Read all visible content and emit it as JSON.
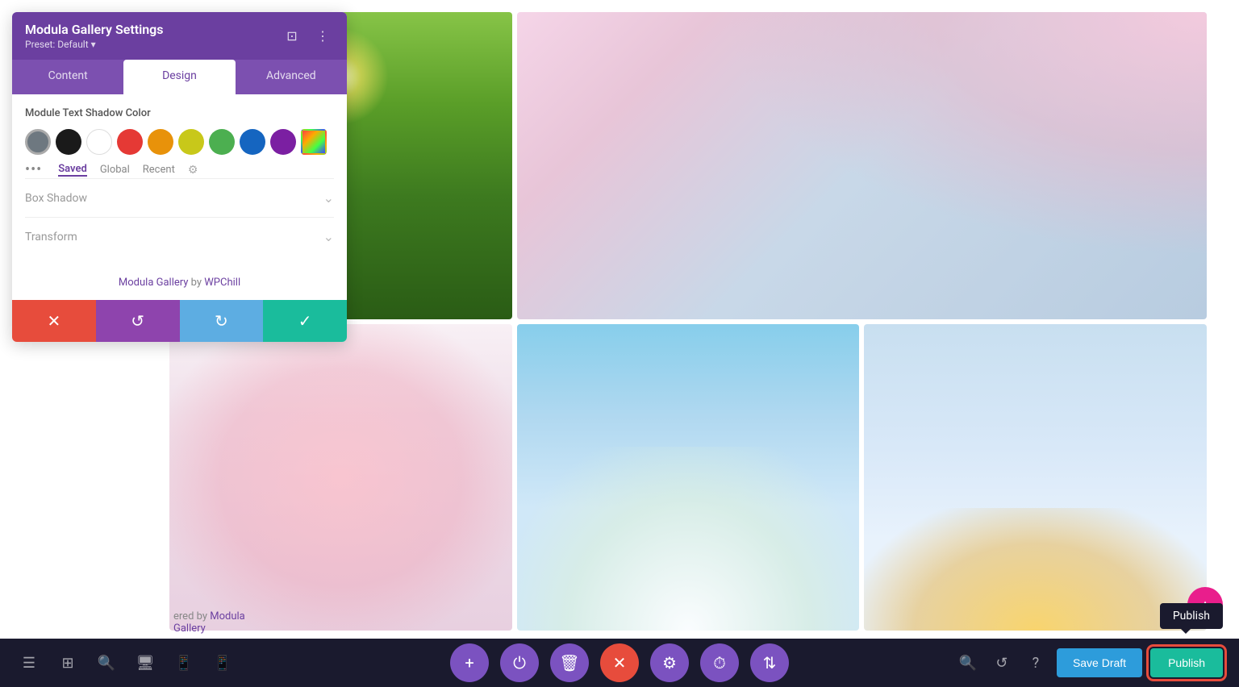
{
  "panel": {
    "title": "Modula Gallery Settings",
    "subtitle": "Preset: Default ▾",
    "tabs": [
      {
        "label": "Content",
        "active": false
      },
      {
        "label": "Design",
        "active": true
      },
      {
        "label": "Advanced",
        "active": false
      }
    ],
    "color_section": {
      "label": "Module Text Shadow Color",
      "color_tabs": [
        "Saved",
        "Global",
        "Recent"
      ],
      "active_color_tab": "Saved"
    },
    "sections": [
      {
        "label": "Box Shadow"
      },
      {
        "label": "Transform"
      }
    ],
    "footer_text": "Modula Gallery",
    "footer_by": " by ",
    "footer_link": "WPChill"
  },
  "actions": {
    "cancel": "✕",
    "undo": "↺",
    "redo": "↻",
    "confirm": "✓"
  },
  "toolbar": {
    "center_buttons": [
      {
        "icon": "+",
        "type": "purple"
      },
      {
        "icon": "⏻",
        "type": "purple"
      },
      {
        "icon": "🗑",
        "type": "purple"
      },
      {
        "icon": "✕",
        "type": "red"
      },
      {
        "icon": "⚙",
        "type": "purple"
      },
      {
        "icon": "⏱",
        "type": "purple"
      },
      {
        "icon": "⇅",
        "type": "purple"
      }
    ],
    "save_draft": "Save Draft",
    "publish": "Publish"
  },
  "publish_tooltip": "Publish",
  "credit": {
    "prefix": "ered by ",
    "link1": "Modula",
    "middle": "\nGallery"
  }
}
